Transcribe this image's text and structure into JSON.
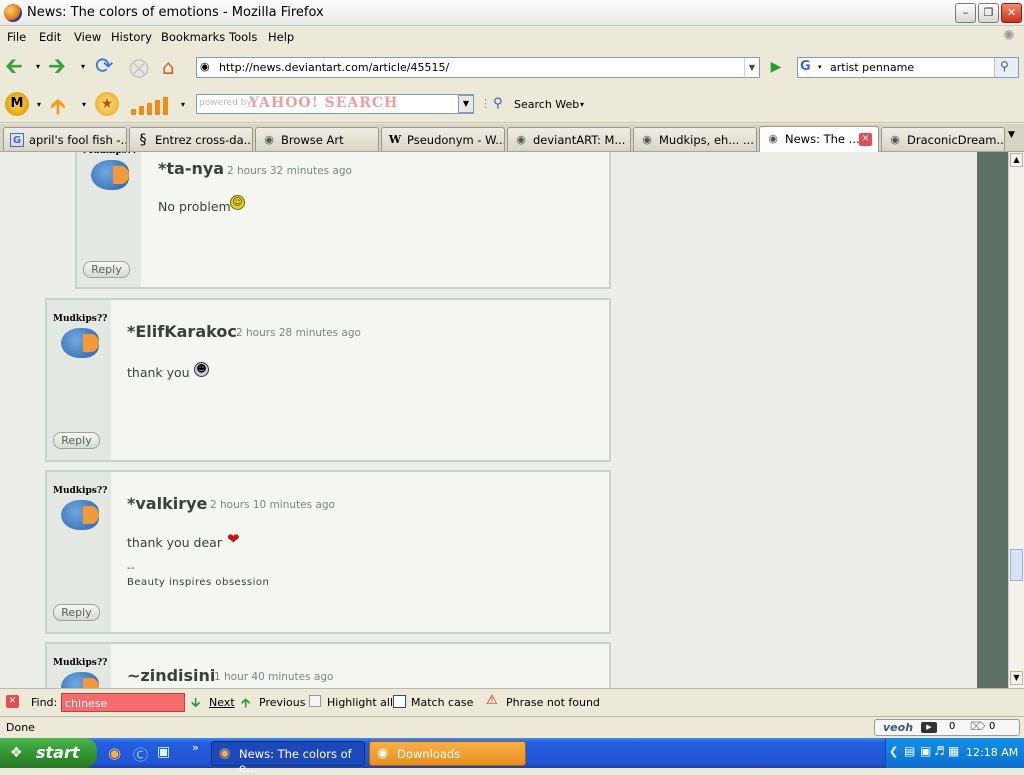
{
  "window": {
    "title": "News: The colors of emotions - Mozilla Firefox"
  },
  "menu": [
    "File",
    "Edit",
    "View",
    "History",
    "Bookmarks",
    "Tools",
    "Help"
  ],
  "nav": {
    "url": "http://news.deviantart.com/article/45515/",
    "search_value": "artist penname"
  },
  "yahoo": {
    "placeholder": "powered by",
    "logo": "YAHOO! SEARCH",
    "search_web": "Search Web"
  },
  "tabs": [
    {
      "label": "april's fool fish -...",
      "icon": "G"
    },
    {
      "label": "Entrez cross-da...",
      "icon": "S"
    },
    {
      "label": "Browse Art",
      "icon": "da"
    },
    {
      "label": "Pseudonym - W...",
      "icon": "W"
    },
    {
      "label": "deviantART: M...",
      "icon": "da"
    },
    {
      "label": "Mudkips, eh... ...",
      "icon": "da"
    },
    {
      "label": "News: The ...",
      "icon": "da"
    },
    {
      "label": "DraconicDream...",
      "icon": "da"
    }
  ],
  "comments": [
    {
      "user": "*ta-nya",
      "time": "2 hours 32 minutes ago",
      "text": "No problem",
      "emoticon": "smile-icon",
      "reply": "Reply"
    },
    {
      "user": "*ElifKarakoc",
      "time": "2 hours 28 minutes ago",
      "text": "thank you",
      "emoticon": "grin-icon",
      "reply": "Reply"
    },
    {
      "user": "*valkirye",
      "time": "2 hours 10 minutes ago",
      "text": "thank you dear",
      "emoticon": "heart-icon",
      "sig_sep": "--",
      "signature": "Beauty inspires obsession",
      "reply": "Reply"
    },
    {
      "user": "~zindisini",
      "time": "1 hour 40 minutes ago"
    }
  ],
  "avatar_text": "Mudkips??",
  "findbar": {
    "label": "Find:",
    "query": "chinese",
    "next": "Next",
    "previous": "Previous",
    "highlight": "Highlight all",
    "match_case": "Match case",
    "status": "Phrase not found"
  },
  "status": {
    "text": "Done",
    "veoh": "veoh",
    "count1": "0",
    "count2": "0"
  },
  "taskbar": {
    "start": "start",
    "items": [
      "News: The colors of e...",
      "Downloads"
    ],
    "clock": "12:18 AM"
  },
  "colors": {
    "page_bg": "#ecefe9",
    "side_bg": "#5e7066",
    "find_error": "#f56c6c"
  }
}
